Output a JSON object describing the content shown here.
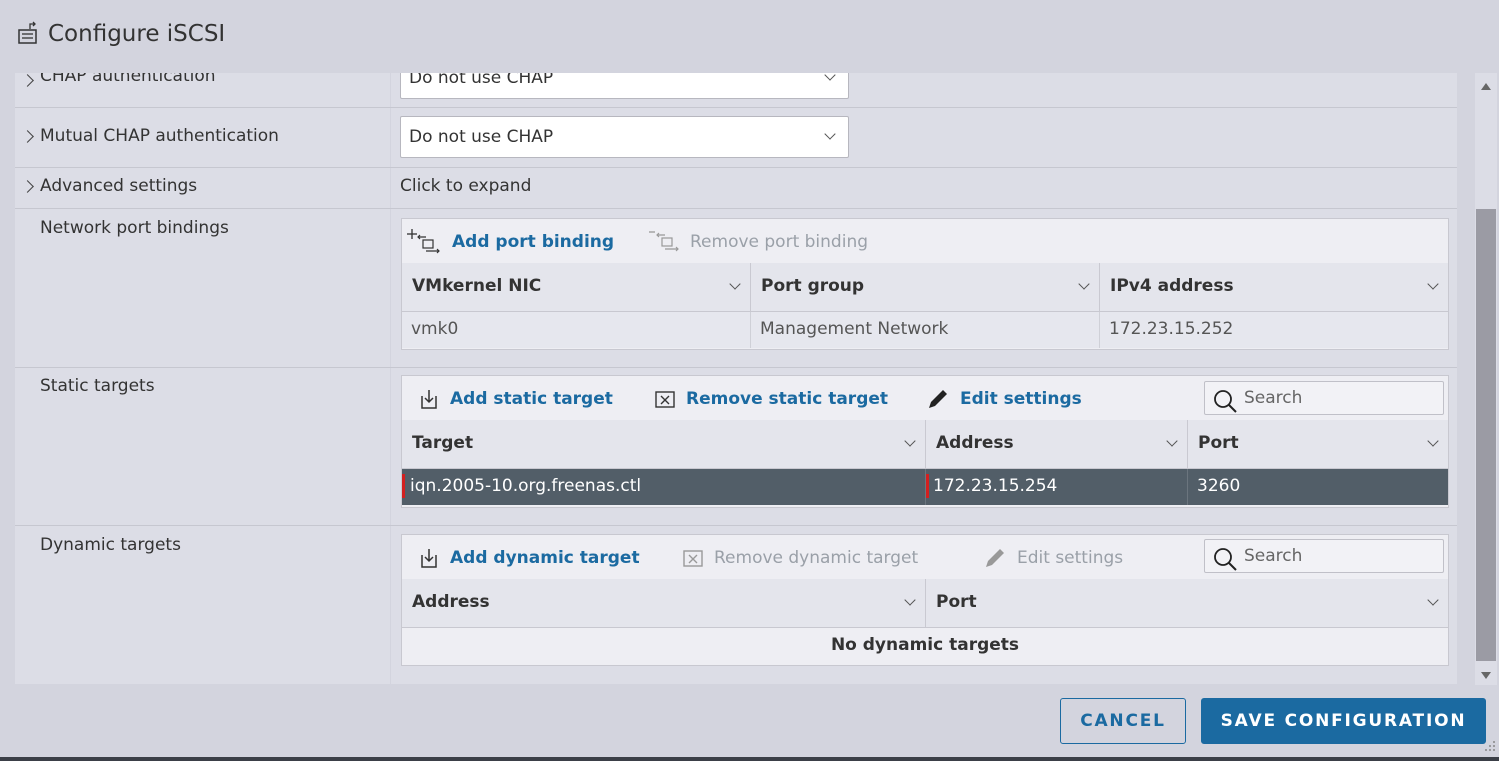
{
  "dialog": {
    "title": "Configure iSCSI",
    "title_icon": "config-icon"
  },
  "rows": {
    "chap": {
      "label": "CHAP authentication",
      "value": "Do not use CHAP"
    },
    "mutual_chap": {
      "label": "Mutual CHAP authentication",
      "value": "Do not use CHAP"
    },
    "advanced": {
      "label": "Advanced settings",
      "value": "Click to expand"
    },
    "port_bindings": {
      "label": "Network port bindings"
    },
    "static_targets": {
      "label": "Static targets"
    },
    "dynamic_targets": {
      "label": "Dynamic targets"
    }
  },
  "port_bindings": {
    "toolbar": {
      "add": "Add port binding",
      "remove": "Remove port binding"
    },
    "columns": [
      "VMkernel NIC",
      "Port group",
      "IPv4 address"
    ],
    "rows": [
      {
        "nic": "vmk0",
        "port_group": "Management Network",
        "ipv4": "172.23.15.252"
      }
    ]
  },
  "static_targets": {
    "toolbar": {
      "add": "Add static target",
      "remove": "Remove static target",
      "edit": "Edit settings",
      "search_placeholder": "Search"
    },
    "columns": [
      "Target",
      "Address",
      "Port"
    ],
    "rows": [
      {
        "target": "iqn.2005-10.org.freenas.ctl",
        "address": "172.23.15.254",
        "port": "3260",
        "selected": true
      }
    ]
  },
  "dynamic_targets": {
    "toolbar": {
      "add": "Add dynamic target",
      "remove": "Remove dynamic target",
      "edit": "Edit settings",
      "search_placeholder": "Search"
    },
    "columns": [
      "Address",
      "Port"
    ],
    "empty_text": "No dynamic targets"
  },
  "footer": {
    "cancel": "CANCEL",
    "save": "SAVE CONFIGURATION"
  },
  "colors": {
    "accent": "#1b6aa1",
    "selected_row": "#525e68",
    "marker": "#d32020"
  }
}
